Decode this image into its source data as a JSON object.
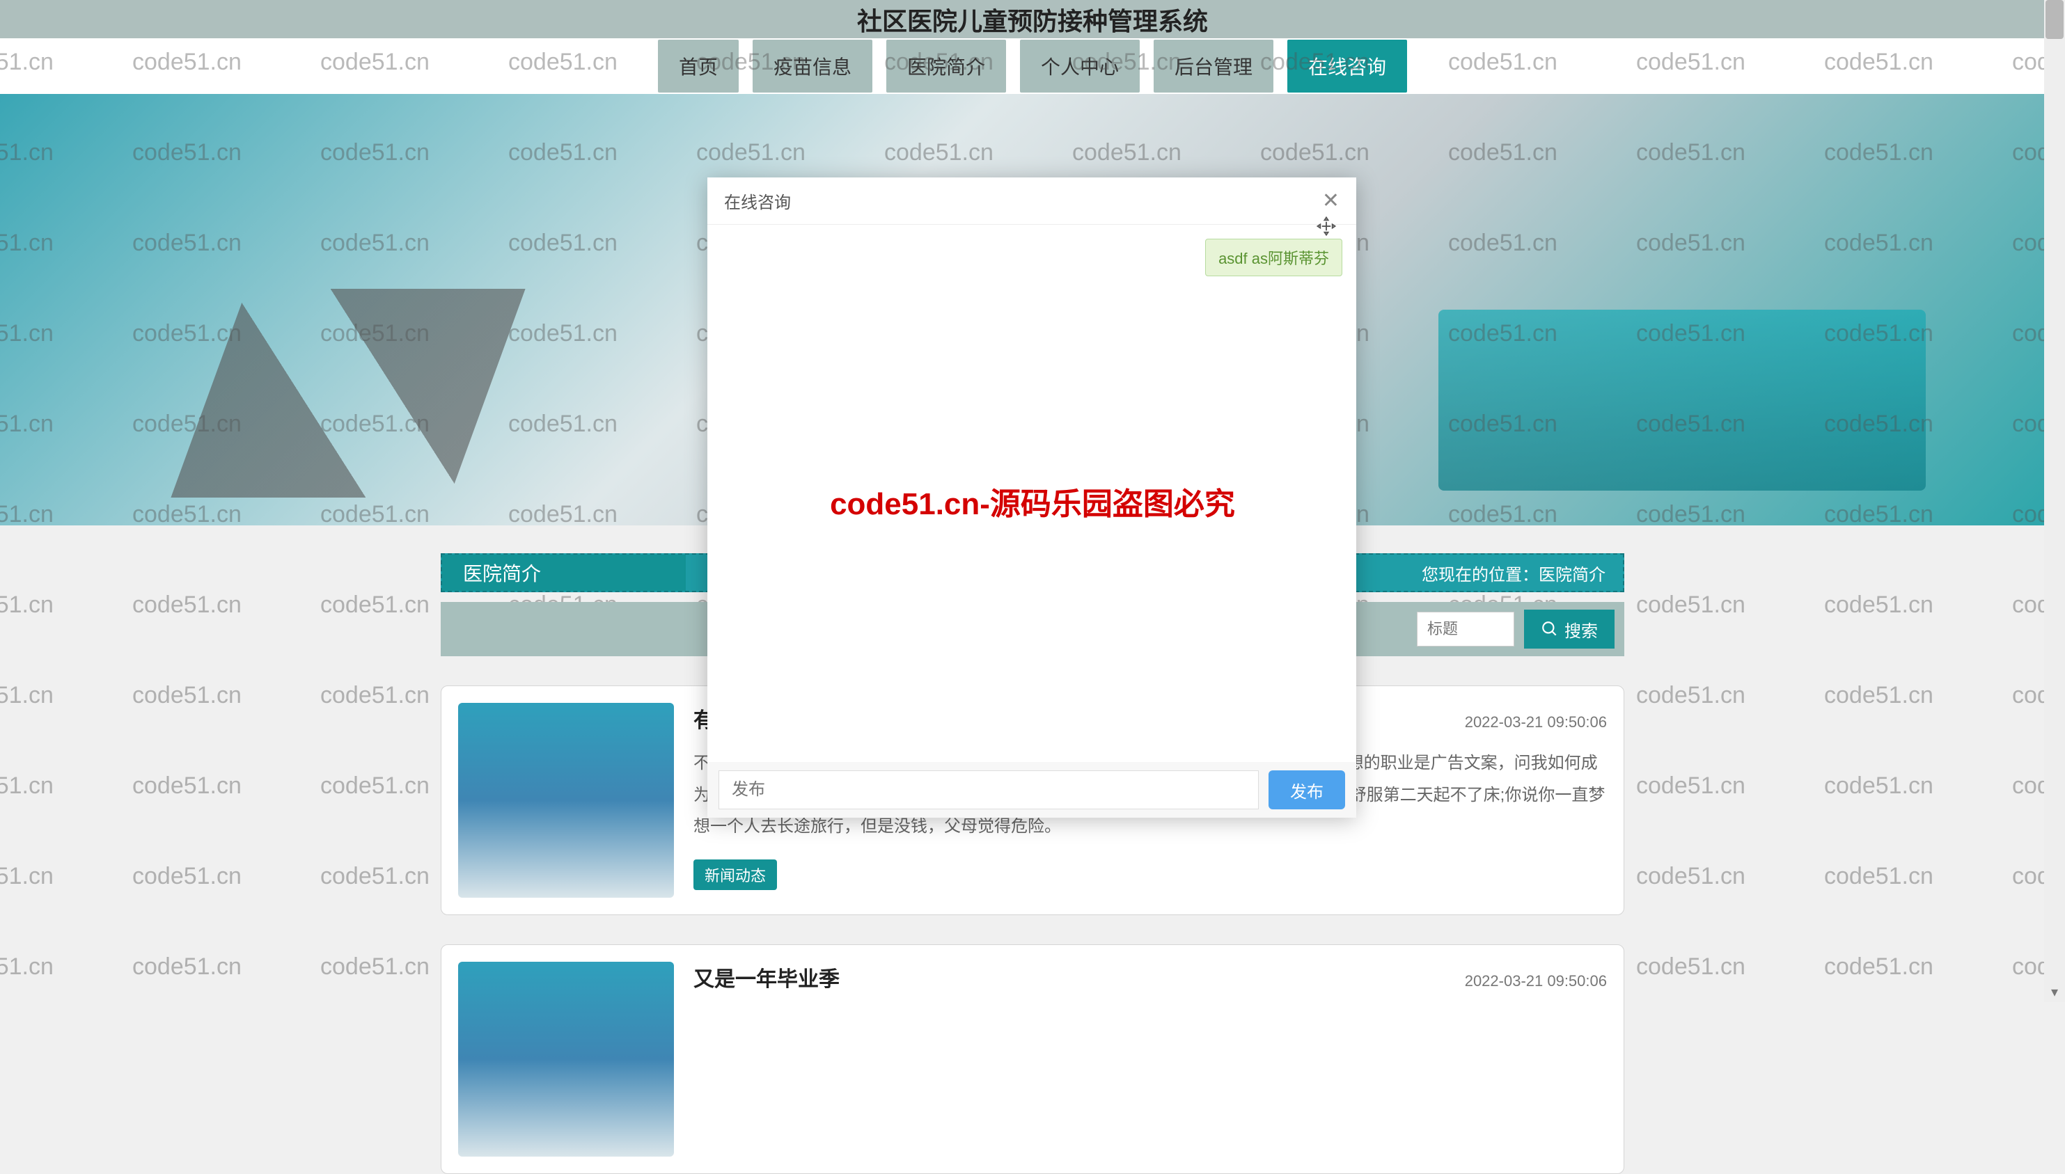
{
  "header": {
    "title": "社区医院儿童预防接种管理系统"
  },
  "nav": {
    "items": [
      {
        "label": "首页",
        "active": false
      },
      {
        "label": "疫苗信息",
        "active": false
      },
      {
        "label": "医院简介",
        "active": false
      },
      {
        "label": "个人中心",
        "active": false
      },
      {
        "label": "后台管理",
        "active": false
      },
      {
        "label": "在线咨询",
        "active": true
      }
    ]
  },
  "section": {
    "title": "医院简介",
    "breadcrumb": "您现在的位置：医院简介"
  },
  "search": {
    "placeholder": "标题",
    "button": "搜索"
  },
  "articles": [
    {
      "title": "有",
      "date": "2022-03-21 09:50:06",
      "excerpt": "不                                                                                                么呢?你说你喜欢读书，让我给你列书单，你还问我哪里有那么多时间看书;你说自己梦想的职业是广告文案，问我如何成为一个文案，应该具备哪些素质;你说你计划晨跑，但总是因为学习、工作辛苦或者身体不舒服第二天起不了床;你说你一直梦想一个人去长途旅行，但是没钱，父母觉得危险。",
      "badge": "新闻动态"
    },
    {
      "title": "又是一年毕业季",
      "date": "2022-03-21 09:50:06",
      "excerpt": "",
      "badge": ""
    }
  ],
  "modal": {
    "title": "在线咨询",
    "message": "asdf as阿斯蒂芬",
    "input_placeholder": "发布",
    "button": "发布"
  },
  "watermark": {
    "text": "code51.cn",
    "red_text": "code51.cn-源码乐园盗图必究"
  }
}
